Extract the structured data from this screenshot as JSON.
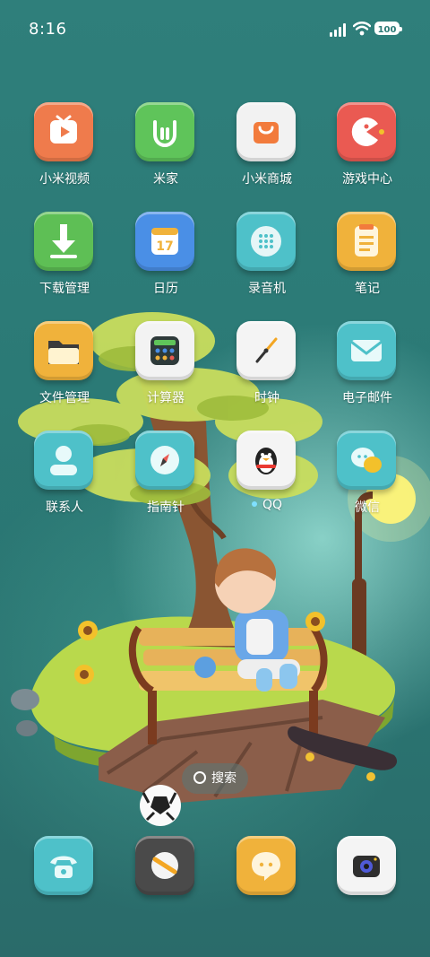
{
  "status_bar": {
    "time": "8:16",
    "battery": "100"
  },
  "apps": {
    "row1": [
      {
        "label": "小米视频",
        "icon": "tv-play-icon",
        "color": "#ef7b4c"
      },
      {
        "label": "米家",
        "icon": "mi-home-icon",
        "color": "#5fc45a"
      },
      {
        "label": "小米商城",
        "icon": "shopping-bag-icon",
        "color": "#f2f2f2"
      },
      {
        "label": "游戏中心",
        "icon": "game-pacman-icon",
        "color": "#ea5a52"
      }
    ],
    "row2": [
      {
        "label": "下载管理",
        "icon": "download-arrow-icon",
        "color": "#5ebf55"
      },
      {
        "label": "日历",
        "icon": "calendar-icon",
        "color": "#4a8fe6",
        "day": "17"
      },
      {
        "label": "录音机",
        "icon": "microphone-grille-icon",
        "color": "#4ec1c9"
      },
      {
        "label": "笔记",
        "icon": "notes-icon",
        "color": "#f0b23b"
      }
    ],
    "row3": [
      {
        "label": "文件管理",
        "icon": "folder-icon",
        "color": "#f0b23b"
      },
      {
        "label": "计算器",
        "icon": "calculator-icon",
        "color": "#f3f3f3"
      },
      {
        "label": "时钟",
        "icon": "clock-icon",
        "color": "#f4f4f4"
      },
      {
        "label": "电子邮件",
        "icon": "envelope-icon",
        "color": "#4ec1c9"
      }
    ],
    "row4": [
      {
        "label": "联系人",
        "icon": "contact-person-icon",
        "color": "#4ec1c9"
      },
      {
        "label": "指南针",
        "icon": "compass-icon",
        "color": "#4ec1c9"
      },
      {
        "label": "QQ",
        "icon": "qq-penguin-icon",
        "color": "#f4f4f4"
      },
      {
        "label": "微信",
        "icon": "wechat-bubble-icon",
        "color": "#4ec1c9"
      }
    ]
  },
  "search": {
    "label": "搜索"
  },
  "dock": [
    {
      "icon": "phone-icon",
      "color": "#4ec1c9"
    },
    {
      "icon": "settings-icon",
      "color": "#4a4a4a"
    },
    {
      "icon": "messages-icon",
      "color": "#f0b23b"
    },
    {
      "icon": "camera-icon",
      "color": "#f4f4f4"
    }
  ]
}
